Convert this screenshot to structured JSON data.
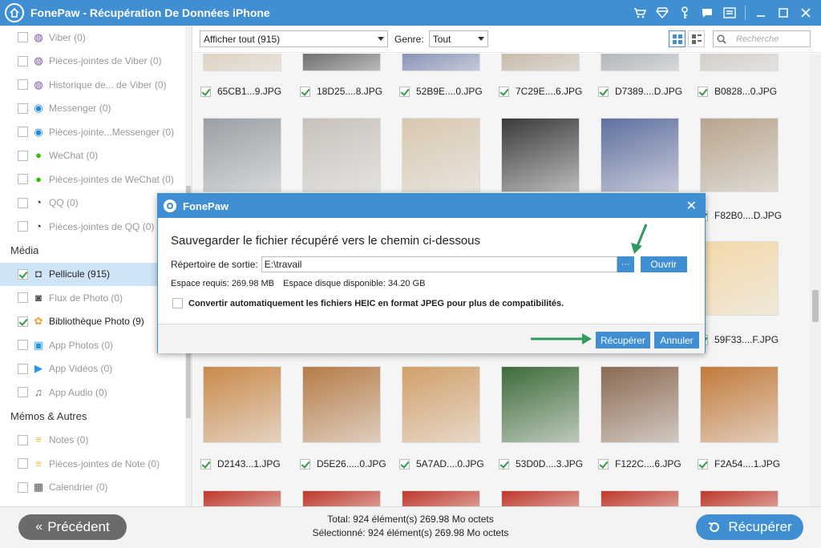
{
  "app": {
    "title": "FonePaw - Récupération De Données iPhone"
  },
  "sidebar": {
    "items": [
      {
        "label": "Viber (0)",
        "checked": false,
        "active": false,
        "icon": "viber-icon",
        "color": "#7b519d"
      },
      {
        "label": "Pièces-jointes de Viber (0)",
        "checked": false,
        "active": false,
        "icon": "viber-icon",
        "color": "#7b519d"
      },
      {
        "label": "Historique de... de Viber (0)",
        "checked": false,
        "active": false,
        "icon": "viber-icon",
        "color": "#7b519d"
      },
      {
        "label": "Messenger (0)",
        "checked": false,
        "active": false,
        "icon": "messenger-icon",
        "color": "#1e88e5"
      },
      {
        "label": "Pièces-jointe...Messenger (0)",
        "checked": false,
        "active": false,
        "icon": "messenger-icon",
        "color": "#1e88e5"
      },
      {
        "label": "WeChat (0)",
        "checked": false,
        "active": false,
        "icon": "wechat-icon",
        "color": "#2dc100"
      },
      {
        "label": "Pièces-jointes de WeChat (0)",
        "checked": false,
        "active": false,
        "icon": "wechat-icon",
        "color": "#2dc100"
      },
      {
        "label": "QQ (0)",
        "checked": false,
        "active": false,
        "icon": "qq-icon",
        "color": "#333333"
      },
      {
        "label": "Pièces-jointes de QQ (0)",
        "checked": false,
        "active": false,
        "icon": "qq-icon",
        "color": "#333333"
      }
    ],
    "media_header": "Média",
    "media_items": [
      {
        "label": "Pellicule (915)",
        "checked": true,
        "active": true,
        "icon": "camera-icon",
        "color": "#444444"
      },
      {
        "label": "Flux de Photo (0)",
        "checked": false,
        "active": false,
        "icon": "photo-stream-icon",
        "color": "#444444"
      },
      {
        "label": "Bibliothèque Photo (9)",
        "checked": true,
        "active": false,
        "icon": "photos-icon",
        "color": "#f0a030"
      },
      {
        "label": "App Photos (0)",
        "checked": false,
        "active": false,
        "icon": "app-photos-icon",
        "color": "#2196f3"
      },
      {
        "label": "App Vidéos (0)",
        "checked": false,
        "active": false,
        "icon": "app-videos-icon",
        "color": "#2196f3"
      },
      {
        "label": "App Audio (0)",
        "checked": false,
        "active": false,
        "icon": "app-audio-icon",
        "color": "#666666"
      }
    ],
    "memo_header": "Mémos & Autres",
    "memo_items": [
      {
        "label": "Notes (0)",
        "checked": false,
        "active": false,
        "icon": "notes-icon",
        "color": "#f5c542"
      },
      {
        "label": "Pièces-jointes de Note (0)",
        "checked": false,
        "active": false,
        "icon": "notes-icon",
        "color": "#f5c542"
      },
      {
        "label": "Calendrier (0)",
        "checked": false,
        "active": false,
        "icon": "calendar-icon",
        "color": "#555555"
      }
    ]
  },
  "toolbar": {
    "filter_value": "Afficher tout (915)",
    "genre_label": "Genre:",
    "genre_value": "Tout",
    "search_placeholder": "Recherche"
  },
  "grid": {
    "row1": [
      "65CB1...9.JPG",
      "18D25....8.JPG",
      "52B9E....0.JPG",
      "7C29E....6.JPG",
      "D7389....D.JPG",
      "B0828...0.JPG"
    ],
    "row2_visible": [
      "F82B0....D.JPG"
    ],
    "row3_visible": [
      "59F33....F.JPG"
    ],
    "row4": [
      "D2143...1.JPG",
      "D5E26.....0.JPG",
      "5A7AD....0.JPG",
      "53D0D....3.JPG",
      "F122C....6.JPG",
      "F2A54....1.JPG"
    ]
  },
  "dialog": {
    "title": "FonePaw",
    "heading": "Sauvegarder le fichier récupéré vers le chemin ci-dessous",
    "output_label": "Répertoire de sortie:",
    "output_path": "E:\\travail",
    "browse": "···",
    "open": "Ouvrir",
    "space_required": "Espace requis: 269.98 MB",
    "space_available": "Espace disque disponible: 34.20 GB",
    "heic_option": "Convertir automatiquement les fichiers HEIC en format JPEG pour plus de compatibilités.",
    "recover": "Récupérer",
    "cancel": "Annuler"
  },
  "footer": {
    "prev": "Précédent",
    "total": "Total: 924 élément(s) 269.98 Mo octets",
    "selected": "Sélectionné: 924 élément(s) 269.98 Mo octets",
    "recover": "Récupérer"
  },
  "colors": {
    "accent": "#3f8fd2",
    "green_arrow": "#2f9a60"
  }
}
